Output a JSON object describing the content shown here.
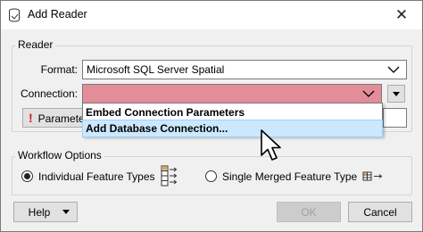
{
  "window": {
    "title": "Add Reader"
  },
  "reader_group": {
    "title": "Reader"
  },
  "format": {
    "label": "Format:",
    "value": "Microsoft SQL Server Spatial"
  },
  "connection": {
    "label": "Connection:",
    "value": ""
  },
  "parameters_button": {
    "label": "Parameters..."
  },
  "connection_menu": {
    "items": [
      {
        "label": "Embed Connection Parameters"
      },
      {
        "label": "Add Database Connection..."
      }
    ]
  },
  "workflow_group": {
    "title": "Workflow Options"
  },
  "workflow_options": {
    "individual": {
      "label": "Individual Feature Types",
      "checked": true
    },
    "merged": {
      "label": "Single Merged Feature Type",
      "checked": false
    }
  },
  "buttons": {
    "help": "Help",
    "ok": "OK",
    "cancel": "Cancel"
  },
  "colors": {
    "invalid_field": "#e38d99",
    "selected_item": "#cce8ff"
  }
}
